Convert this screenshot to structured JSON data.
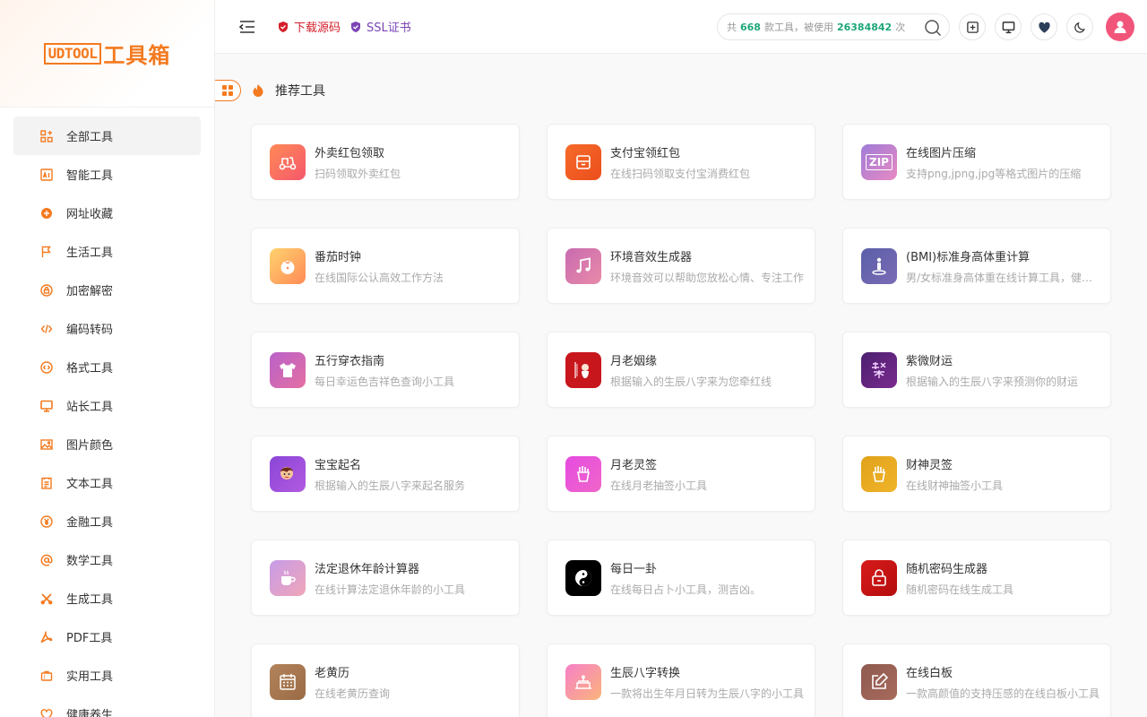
{
  "sidebar": {
    "logo": {
      "box_text": "UDTOOL",
      "cn_text": "工具箱"
    },
    "items": [
      {
        "label": "全部工具",
        "icon": "grid-plus-icon"
      },
      {
        "label": "智能工具",
        "icon": "ai-icon"
      },
      {
        "label": "网址收藏",
        "icon": "browser-icon"
      },
      {
        "label": "生活工具",
        "icon": "flag-icon"
      },
      {
        "label": "加密解密",
        "icon": "lock-icon"
      },
      {
        "label": "编码转码",
        "icon": "code-icon"
      },
      {
        "label": "格式工具",
        "icon": "format-icon"
      },
      {
        "label": "站长工具",
        "icon": "monitor-icon"
      },
      {
        "label": "图片颜色",
        "icon": "image-icon"
      },
      {
        "label": "文本工具",
        "icon": "document-icon"
      },
      {
        "label": "金融工具",
        "icon": "yen-icon"
      },
      {
        "label": "数学工具",
        "icon": "at-icon"
      },
      {
        "label": "生成工具",
        "icon": "tools-icon"
      },
      {
        "label": "PDF工具",
        "icon": "pdf-icon"
      },
      {
        "label": "实用工具",
        "icon": "briefcase-icon"
      },
      {
        "label": "健康养生",
        "icon": "heart-icon"
      }
    ]
  },
  "header": {
    "download_label": "下载源码",
    "ssl_label": "SSL证书",
    "search": {
      "prefix": "共",
      "tool_count": "668",
      "middle": "款工具，被使用",
      "use_count": "26384842",
      "suffix": "次"
    }
  },
  "section": {
    "title": "推荐工具"
  },
  "colors": {
    "accent": "#f47a1f",
    "count_green": "#1ea77a",
    "avatar": "#f2557a"
  },
  "cards": [
    {
      "title": "外卖红包领取",
      "desc": "扫码领取外卖红包",
      "icon": "scooter-icon"
    },
    {
      "title": "支付宝领红包",
      "desc": "在线扫码领取支付宝消费红包",
      "icon": "red-packet-icon"
    },
    {
      "title": "在线图片压缩",
      "desc": "支持png,jpng,jpg等格式图片的压缩",
      "icon": "zip-icon",
      "icon_text": "ZIP"
    },
    {
      "title": "番茄时钟",
      "desc": "在线国际公认高效工作方法",
      "icon": "tomato-icon"
    },
    {
      "title": "环境音效生成器",
      "desc": "环境音效可以帮助您放松心情、专注工作",
      "icon": "music-note-icon"
    },
    {
      "title": "(BMI)标准身高体重计算",
      "desc": "男/女标准身高体重在线计算工具，健康指数",
      "icon": "person-standing-icon"
    },
    {
      "title": "五行穿衣指南",
      "desc": "每日幸运色吉祥色查询小工具",
      "icon": "tshirt-icon"
    },
    {
      "title": "月老姻缘",
      "desc": "根据输入的生辰八字来为您牵红线",
      "icon": "yuelao-icon"
    },
    {
      "title": "紫微财运",
      "desc": "根据输入的生辰八字来预测你的财运",
      "icon": "ziwei-icon"
    },
    {
      "title": "宝宝起名",
      "desc": "根据输入的生辰八字来起名服务",
      "icon": "baby-name-icon"
    },
    {
      "title": "月老灵签",
      "desc": "在线月老抽签小工具",
      "icon": "fortune-sticks-icon"
    },
    {
      "title": "财神灵签",
      "desc": "在线财神抽签小工具",
      "icon": "fortune-sticks-icon"
    },
    {
      "title": "法定退休年龄计算器",
      "desc": "在线计算法定退休年龄的小工具",
      "icon": "coffee-cup-icon"
    },
    {
      "title": "每日一卦",
      "desc": "在线每日占卜小工具，测吉凶。",
      "icon": "yin-yang-icon"
    },
    {
      "title": "随机密码生成器",
      "desc": "随机密码在线生成工具",
      "icon": "padlock-icon"
    },
    {
      "title": "老黄历",
      "desc": "在线老黄历查询",
      "icon": "calendar-icon"
    },
    {
      "title": "生辰八字转换",
      "desc": "一款将出生年月日转为生辰八字的小工具",
      "icon": "cake-icon"
    },
    {
      "title": "在线白板",
      "desc": "一款高颜值的支持压感的在线白板小工具",
      "icon": "whiteboard-icon"
    }
  ]
}
